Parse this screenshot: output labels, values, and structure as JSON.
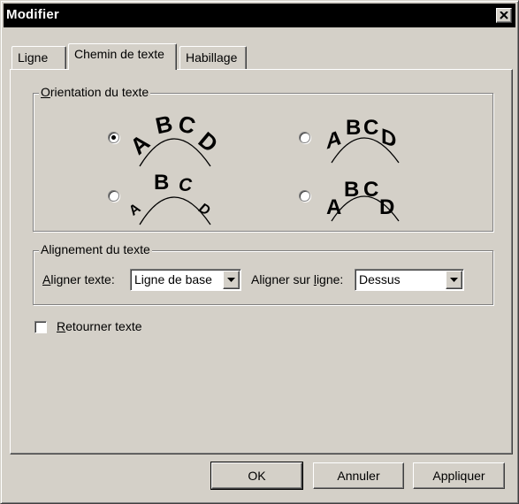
{
  "window": {
    "title": "Modifier",
    "close_icon": "close-icon"
  },
  "tabs": [
    {
      "label": "Ligne",
      "active": false
    },
    {
      "label": "Chemin de texte",
      "active": true
    },
    {
      "label": "Habillage",
      "active": false
    }
  ],
  "orientation": {
    "label": "Orientation du texte",
    "options": [
      {
        "letters": "ABCD",
        "style": "rotated",
        "selected": true
      },
      {
        "letters": "ABCD",
        "style": "skewed",
        "selected": false
      },
      {
        "letters": "ABCD",
        "style": "perspective",
        "selected": false
      },
      {
        "letters": "ABCD",
        "style": "upright",
        "selected": false
      }
    ]
  },
  "alignment": {
    "label": "Alignement du texte",
    "align_text_label_u": "A",
    "align_text_label_rest": "ligner texte:",
    "align_text_value": "Ligne de base",
    "align_line_label_pre": "Aligner sur ",
    "align_line_label_u": "l",
    "align_line_label_rest": "igne:",
    "align_line_value": "Dessus"
  },
  "reverse": {
    "label_u": "R",
    "label_rest": "etourner texte",
    "checked": false
  },
  "buttons": {
    "ok": "OK",
    "cancel": "Annuler",
    "apply": "Appliquer"
  }
}
